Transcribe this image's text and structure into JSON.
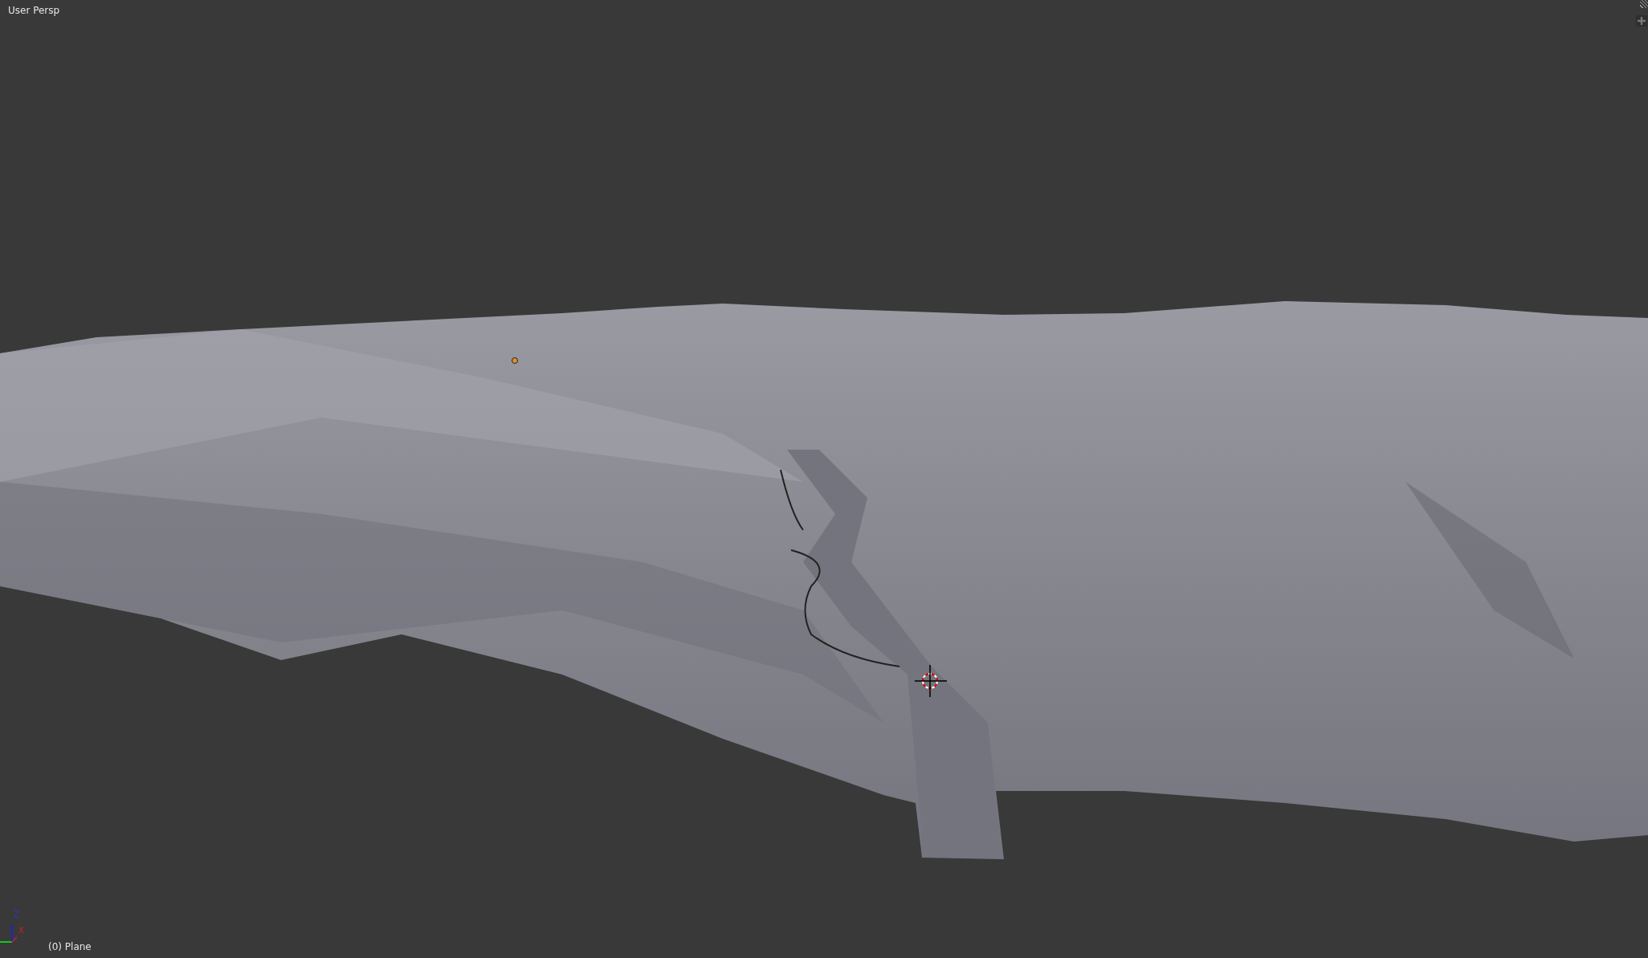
{
  "viewport": {
    "view_label": "User Persp",
    "object_label": "(0) Plane"
  },
  "axis_gizmo": {
    "labels": [
      "Z",
      "X"
    ]
  }
}
